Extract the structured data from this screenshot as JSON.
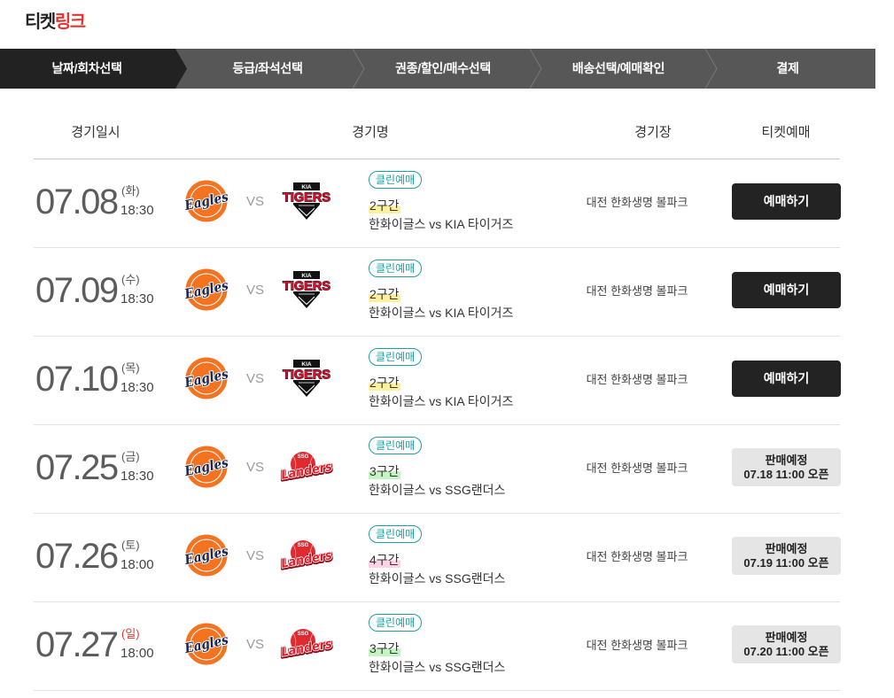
{
  "brand": {
    "logo_part1": "티켓",
    "logo_part2": "링크"
  },
  "colors": {
    "accent": "#e8332d",
    "step_bg": "#575757",
    "step_active_bg": "#222222",
    "badge": "#1d9fa2",
    "book_button_bg": "#232323",
    "scheduled_button_bg": "#e5e5e5"
  },
  "steps": [
    {
      "label": "날짜/회차선택",
      "active": true
    },
    {
      "label": "등급/좌석선택",
      "active": false
    },
    {
      "label": "권종/할인/매수선택",
      "active": false
    },
    {
      "label": "배송선택/예매확인",
      "active": false
    },
    {
      "label": "결제",
      "active": false
    }
  ],
  "table": {
    "headers": {
      "datetime": "경기일시",
      "match": "경기명",
      "venue": "경기장",
      "booking": "티켓예매"
    },
    "vs_label": "VS"
  },
  "logos": {
    "eagles": {
      "wordmark": "Eagles"
    },
    "tigers": {
      "wordmark": "TIGERS",
      "emblem": "KIA"
    },
    "landers": {
      "wordmark": "Landers",
      "emblem": "SSG"
    }
  },
  "games": [
    {
      "date": "07.08",
      "day": "(화)",
      "day_color": "#555555",
      "time": "18:30",
      "home_logo": "eagles-logo",
      "away_logo": "tigers-logo",
      "badge": "클린예매",
      "zone": "2구간",
      "zone_color": "#fff19c",
      "match": "한화이글스 vs KIA 타이거즈",
      "venue": "대전 한화생명 볼파크",
      "button": {
        "label": "예매하기"
      }
    },
    {
      "date": "07.09",
      "day": "(수)",
      "day_color": "#555555",
      "time": "18:30",
      "home_logo": "eagles-logo",
      "away_logo": "tigers-logo",
      "badge": "클린예매",
      "zone": "2구간",
      "zone_color": "#fff19c",
      "match": "한화이글스 vs KIA 타이거즈",
      "venue": "대전 한화생명 볼파크",
      "button": {
        "label": "예매하기"
      }
    },
    {
      "date": "07.10",
      "day": "(목)",
      "day_color": "#555555",
      "time": "18:30",
      "home_logo": "eagles-logo",
      "away_logo": "tigers-logo",
      "badge": "클린예매",
      "zone": "2구간",
      "zone_color": "#fff19c",
      "match": "한화이글스 vs KIA 타이거즈",
      "venue": "대전 한화생명 볼파크",
      "button": {
        "label": "예매하기"
      }
    },
    {
      "date": "07.25",
      "day": "(금)",
      "day_color": "#555555",
      "time": "18:30",
      "home_logo": "eagles-logo",
      "away_logo": "landers-logo",
      "badge": "클린예매",
      "zone": "3구간",
      "zone_color": "#c6f3c2",
      "match": "한화이글스 vs SSG랜더스",
      "venue": "대전 한화생명 볼파크",
      "button": {
        "line1": "판매예정",
        "line2": "07.18 11:00 오픈"
      }
    },
    {
      "date": "07.26",
      "day": "(토)",
      "day_color": "#555555",
      "time": "18:00",
      "home_logo": "eagles-logo",
      "away_logo": "landers-logo",
      "badge": "클린예매",
      "zone": "4구간",
      "zone_color": "#ffd3e4",
      "match": "한화이글스 vs SSG랜더스",
      "venue": "대전 한화생명 볼파크",
      "button": {
        "line1": "판매예정",
        "line2": "07.19 11:00 오픈"
      }
    },
    {
      "date": "07.27",
      "day": "(일)",
      "day_color": "#e0392f",
      "time": "18:00",
      "home_logo": "eagles-logo",
      "away_logo": "landers-logo",
      "badge": "클린예매",
      "zone": "3구간",
      "zone_color": "#c6f3c2",
      "match": "한화이글스 vs SSG랜더스",
      "venue": "대전 한화생명 볼파크",
      "button": {
        "line1": "판매예정",
        "line2": "07.20 11:00 오픈"
      }
    }
  ]
}
